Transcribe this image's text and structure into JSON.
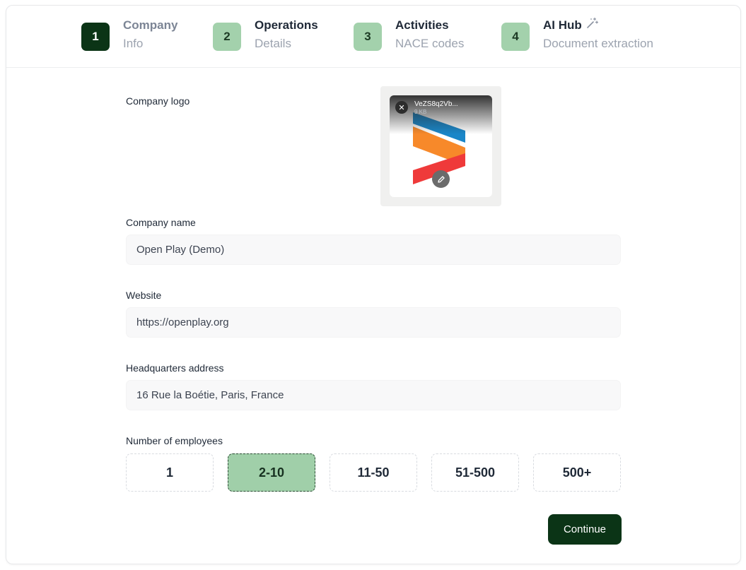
{
  "steps": [
    {
      "number": "1",
      "title": "Company",
      "subtitle": "Info",
      "state": "active"
    },
    {
      "number": "2",
      "title": "Operations",
      "subtitle": "Details",
      "state": "idle"
    },
    {
      "number": "3",
      "title": "Activities",
      "subtitle": "NACE codes",
      "state": "idle"
    },
    {
      "number": "4",
      "title": "AI Hub",
      "subtitle": "Document extraction",
      "state": "idle",
      "icon": "magic-wand-icon"
    }
  ],
  "form": {
    "logo": {
      "label": "Company logo",
      "file_name": "VeZS8q2Vb...",
      "file_size": "9 KB"
    },
    "company_name": {
      "label": "Company name",
      "value": "Open Play (Demo)"
    },
    "website": {
      "label": "Website",
      "value": "https://openplay.org"
    },
    "address": {
      "label": "Headquarters address",
      "value": "16 Rue la Boétie, Paris, France"
    },
    "employees": {
      "label": "Number of employees",
      "options": [
        "1",
        "2-10",
        "11-50",
        "51-500",
        "500+"
      ],
      "selected": "2-10"
    },
    "continue_label": "Continue"
  },
  "colors": {
    "primary": "#0b3416",
    "step_idle": "#a3d1ac",
    "selected_option": "#a0cfa9",
    "logo_blue": "#1a86c8",
    "logo_orange": "#f7892a",
    "logo_red": "#ef3a3a"
  }
}
